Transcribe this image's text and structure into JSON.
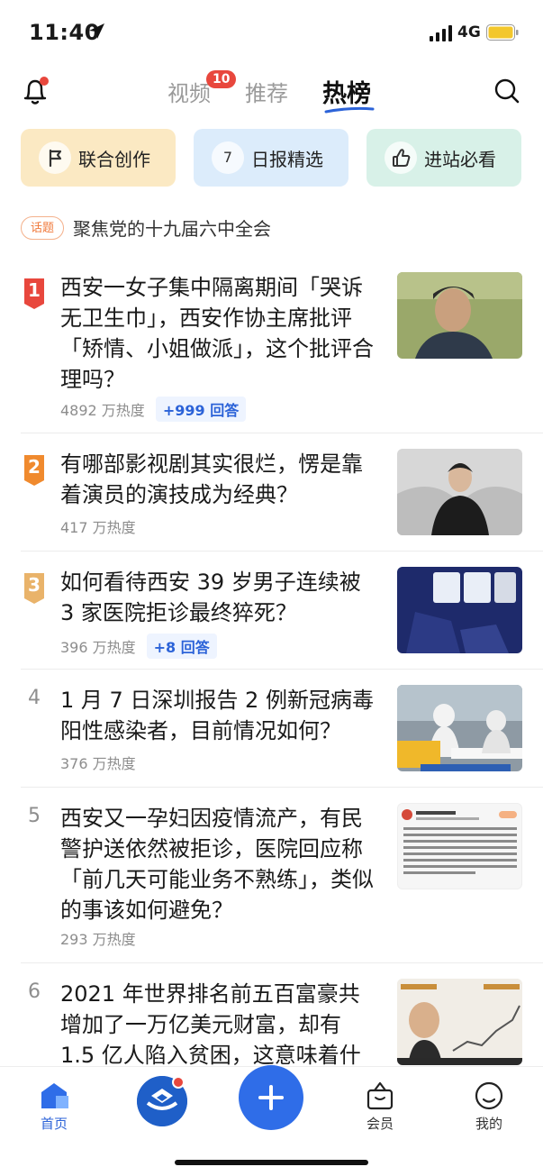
{
  "status": {
    "time": "11:40",
    "network": "4G"
  },
  "nav": {
    "tabs": [
      {
        "label": "视频",
        "badge": "10"
      },
      {
        "label": "推荐"
      },
      {
        "label": "热榜"
      }
    ]
  },
  "chips": [
    {
      "label": "联合创作",
      "icon": "flag-icon"
    },
    {
      "label": "日报精选",
      "icon_text": "7"
    },
    {
      "label": "进站必看",
      "icon": "thumbs-up-icon"
    }
  ],
  "topic": {
    "tag": "话题",
    "text": "聚焦党的十九届六中全会"
  },
  "hot_list": [
    {
      "rank": "1",
      "title": "西安一女子集中隔离期间「哭诉无卫生巾」，西安作协主席批评「矫情、小姐做派」，这个批评合理吗？",
      "heat": "4892 万热度",
      "answers": "+999 回答"
    },
    {
      "rank": "2",
      "title": "有哪部影视剧其实很烂，愣是靠着演员的演技成为经典？",
      "heat": "417 万热度"
    },
    {
      "rank": "3",
      "title": "如何看待西安 39 岁男子连续被 3 家医院拒诊最终猝死？",
      "heat": "396 万热度",
      "answers": "+8 回答"
    },
    {
      "rank": "4",
      "title": "1 月 7 日深圳报告 2 例新冠病毒阳性感染者，目前情况如何？",
      "heat": "376 万热度"
    },
    {
      "rank": "5",
      "title": "西安又一孕妇因疫情流产，有民警护送依然被拒诊，医院回应称「前几天可能业务不熟练」，类似的事该如何避免？",
      "heat": "293 万热度"
    },
    {
      "rank": "6",
      "title": "2021 年世界排名前五百富豪共增加了一万亿美元财富，却有 1.5 亿人陷入贫困，这意味着什",
      "heat": ""
    }
  ],
  "tabbar": {
    "home": "首页",
    "vip": "会员",
    "me": "我的"
  },
  "colors": {
    "accent": "#2c63d8",
    "hot_red": "#e8473d",
    "rank2": "#f08a2e",
    "rank3": "#e9b36a"
  }
}
